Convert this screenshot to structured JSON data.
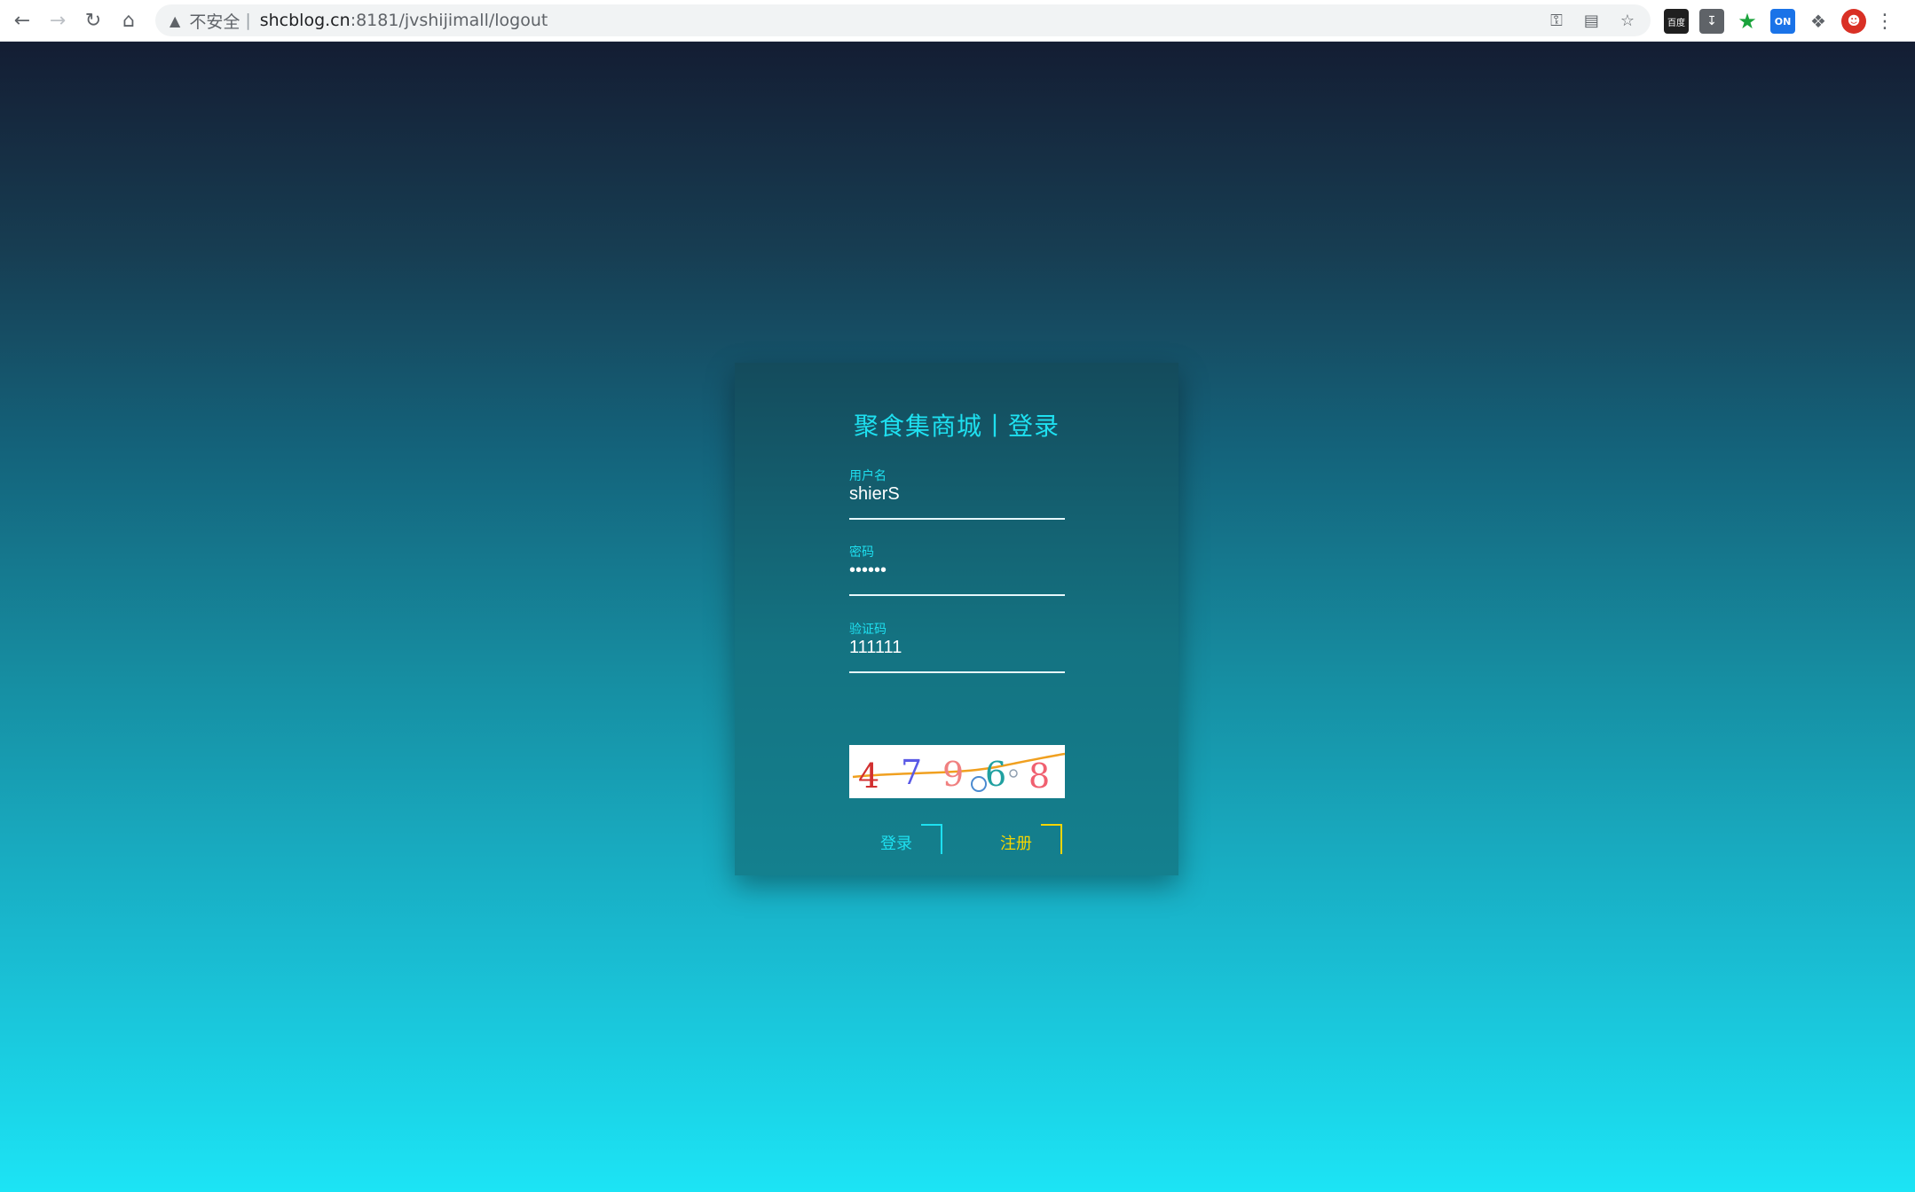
{
  "browser": {
    "back_icon": "arrow-left",
    "forward_icon": "arrow-right",
    "reload_icon": "reload",
    "home_icon": "home",
    "security_label": "不安全",
    "url_host": "shcblog.cn",
    "url_path": ":8181/jvshijimall/logout",
    "extensions": {
      "baidu": "百度",
      "on": "ON"
    }
  },
  "login": {
    "title": "聚食集商城丨登录",
    "username_label": "用户名",
    "username_value": "shierS",
    "password_label": "密码",
    "password_value": "••••••",
    "captcha_label": "验证码",
    "captcha_value": "111111",
    "captcha_chars": [
      "4",
      "7",
      "9",
      "6",
      "8"
    ],
    "login_button": "登录",
    "register_button": "注册"
  },
  "colors": {
    "accent_cyan": "#1ee0f0",
    "accent_yellow": "#f5d500"
  }
}
